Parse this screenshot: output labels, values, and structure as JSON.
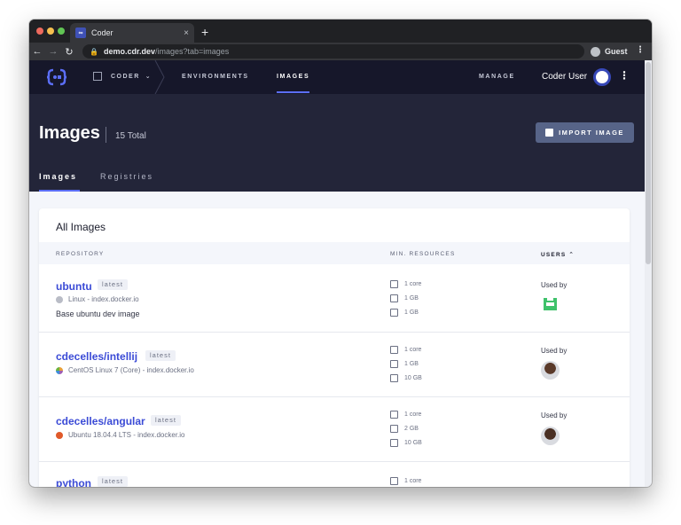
{
  "browser": {
    "tab_title": "Coder",
    "tab_close": "×",
    "new_tab": "+",
    "url_host": "demo.cdr.dev",
    "url_path": "/images?tab=images",
    "profile": "Guest"
  },
  "nav": {
    "org": "CODER",
    "links": [
      "ENVIRONMENTS",
      "IMAGES",
      "MANAGE"
    ],
    "user_name": "Coder User"
  },
  "header": {
    "title": "Images",
    "total": "15 Total",
    "import_button": "IMPORT IMAGE",
    "tabs": [
      "Images",
      "Registries"
    ]
  },
  "table": {
    "card_title": "All Images",
    "columns": [
      "REPOSITORY",
      "MIN. RESOURCES",
      "USERS ⌃"
    ],
    "rows": [
      {
        "name": "ubuntu",
        "tag": "latest",
        "os": "Linux - index.docker.io",
        "desc": "Base ubuntu dev image",
        "cpu": "1 core",
        "mem": "1 GB",
        "disk": "1 GB",
        "used_by": "Used by"
      },
      {
        "name": "cdecelles/intellij",
        "tag": "latest",
        "os": "CentOS Linux 7 (Core) - index.docker.io",
        "desc": "",
        "cpu": "1 core",
        "mem": "1 GB",
        "disk": "10 GB",
        "used_by": "Used by"
      },
      {
        "name": "cdecelles/angular",
        "tag": "latest",
        "os": "Ubuntu 18.04.4 LTS - index.docker.io",
        "desc": "",
        "cpu": "1 core",
        "mem": "2 GB",
        "disk": "10 GB",
        "used_by": "Used by"
      },
      {
        "name": "python",
        "tag": "latest",
        "os": "",
        "desc": "",
        "cpu": "1 core",
        "mem": "",
        "disk": "",
        "used_by": ""
      }
    ]
  },
  "colors": {
    "accent": "#5b6ef5",
    "link": "#3b4bd6",
    "nav_bg": "#16172a",
    "header_bg": "#232539"
  }
}
